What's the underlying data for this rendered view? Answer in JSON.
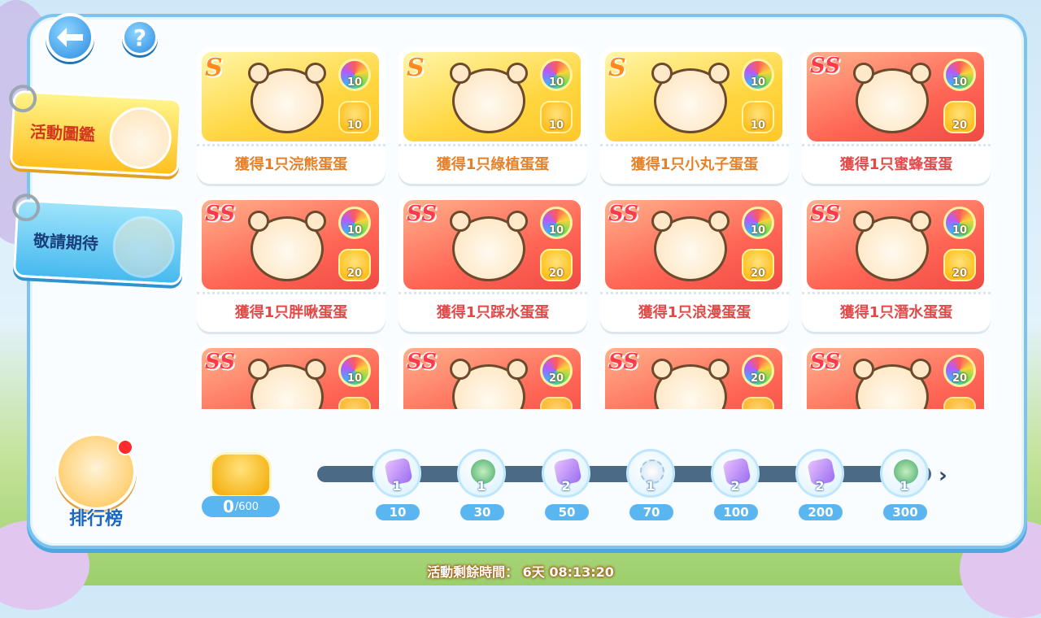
{
  "nav": {
    "back_icon": "back-arrow-icon",
    "help_label": "?"
  },
  "tabs": [
    {
      "label": "活動圖鑑",
      "active": true
    },
    {
      "label": "敬請期待",
      "active": false
    }
  ],
  "cards": [
    {
      "rank": "S",
      "theme": "yellow",
      "gem": "10",
      "coin": "10",
      "label": "獲得1只浣熊蛋蛋"
    },
    {
      "rank": "S",
      "theme": "yellow",
      "gem": "10",
      "coin": "10",
      "label": "獲得1只綠植蛋蛋"
    },
    {
      "rank": "S",
      "theme": "yellow",
      "gem": "10",
      "coin": "10",
      "label": "獲得1只小丸子蛋蛋"
    },
    {
      "rank": "SS",
      "theme": "red",
      "gem": "10",
      "coin": "20",
      "label": "獲得1只蜜蜂蛋蛋"
    },
    {
      "rank": "SS",
      "theme": "red",
      "gem": "10",
      "coin": "20",
      "label": "獲得1只胖啾蛋蛋"
    },
    {
      "rank": "SS",
      "theme": "red",
      "gem": "10",
      "coin": "20",
      "label": "獲得1只踩水蛋蛋"
    },
    {
      "rank": "SS",
      "theme": "red",
      "gem": "10",
      "coin": "20",
      "label": "獲得1只浪漫蛋蛋"
    },
    {
      "rank": "SS",
      "theme": "red",
      "gem": "10",
      "coin": "20",
      "label": "獲得1只潛水蛋蛋"
    },
    {
      "rank": "SS",
      "theme": "red",
      "gem": "10",
      "coin": "",
      "label": ""
    },
    {
      "rank": "SS",
      "theme": "red",
      "gem": "20",
      "coin": "",
      "label": ""
    },
    {
      "rank": "SS",
      "theme": "red",
      "gem": "20",
      "coin": "",
      "label": ""
    },
    {
      "rank": "SS",
      "theme": "red",
      "gem": "20",
      "coin": "",
      "label": ""
    }
  ],
  "ranking": {
    "label": "排行榜"
  },
  "tokens": {
    "current": "0",
    "max": "/600"
  },
  "milestones": [
    {
      "item": "cube",
      "count": "1",
      "value": "10"
    },
    {
      "item": "figure",
      "count": "1",
      "value": "30"
    },
    {
      "item": "cube",
      "count": "2",
      "value": "50"
    },
    {
      "item": "accessory",
      "count": "1",
      "value": "70"
    },
    {
      "item": "cube",
      "count": "2",
      "value": "100"
    },
    {
      "item": "cube",
      "count": "2",
      "value": "200"
    },
    {
      "item": "figure",
      "count": "1",
      "value": "300"
    }
  ],
  "next_icon": "›",
  "timer": "活動剩餘時間： 6天 08:13:20",
  "colors": {
    "accent_blue": "#5ab6f0",
    "tab_active": "#ffc021",
    "card_red": "#ff6555",
    "card_yellow": "#ffd640"
  }
}
